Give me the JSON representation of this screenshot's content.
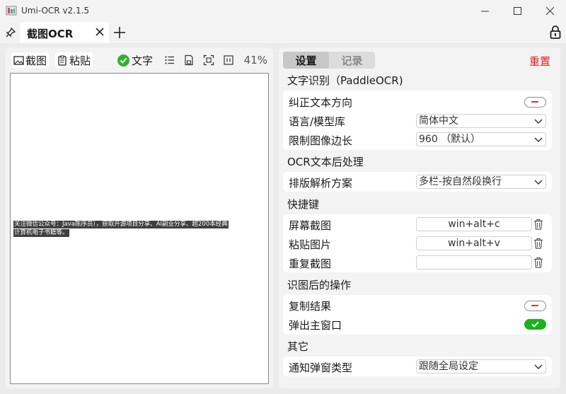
{
  "window": {
    "title": "Umi-OCR v2.1.5",
    "minimize_icon": "minimize-icon",
    "maximize_icon": "maximize-icon",
    "close_icon": "close-icon"
  },
  "tabs": {
    "active_label": "截图OCR",
    "pin_icon": "pin-icon",
    "lock_icon": "lock-icon"
  },
  "left": {
    "screenshot_label": "截图",
    "paste_label": "粘贴",
    "text_label": "文字",
    "zoom": "41%",
    "ocr_lines": [
      "关注微信公众号：Java陈序员），获取开源项目分享、AI副业分享、超200本经典",
      "计算机电子书籍等。"
    ]
  },
  "right": {
    "tab_settings": "设置",
    "tab_records": "记录",
    "reset": "重置",
    "sec_ocr": "文字识别（PaddleOCR)",
    "row_correct": "纠正文本方向",
    "row_language": "语言/模型库",
    "language_value": "简体中文",
    "row_limit": "限制图像边长",
    "limit_value": "960 （默认）",
    "sec_post": "OCR文本后处理",
    "row_layout": "排版解析方案",
    "layout_value": "多栏-按自然段换行",
    "sec_hotkey": "快捷键",
    "row_screenshot": "屏幕截图",
    "hotkey_screenshot": "win+alt+c",
    "row_paste": "粘贴图片",
    "hotkey_paste": "win+alt+v",
    "row_repeat": "重复截图",
    "hotkey_repeat": "",
    "sec_after": "识图后的操作",
    "row_copy": "复制结果",
    "row_popup": "弹出主窗口",
    "sec_other": "其它",
    "row_notify": "通知弹窗类型",
    "notify_value": "跟随全局设定"
  },
  "colors": {
    "accent_green": "#19b219",
    "reset_red": "#e02020"
  }
}
